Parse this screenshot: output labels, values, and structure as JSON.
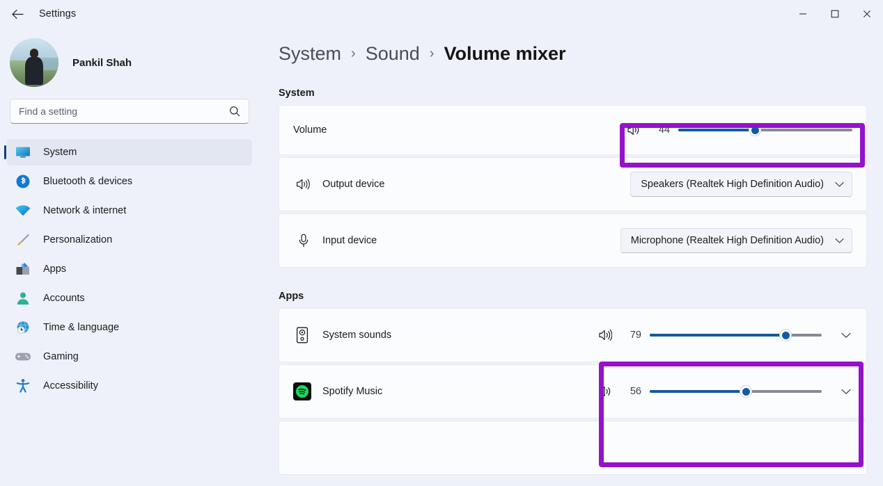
{
  "titlebar": {
    "back_label": "Back",
    "title": "Settings",
    "minimize": "—",
    "maximize": "☐",
    "close": "✕"
  },
  "sidebar": {
    "profile": {
      "name": "Pankil Shah"
    },
    "search": {
      "placeholder": "Find a setting",
      "value": ""
    },
    "items": [
      {
        "label": "System",
        "icon": "monitor-icon",
        "active": true
      },
      {
        "label": "Bluetooth & devices",
        "icon": "bluetooth-icon",
        "active": false
      },
      {
        "label": "Network & internet",
        "icon": "wifi-icon",
        "active": false
      },
      {
        "label": "Personalization",
        "icon": "paintbrush-icon",
        "active": false
      },
      {
        "label": "Apps",
        "icon": "apps-icon",
        "active": false
      },
      {
        "label": "Accounts",
        "icon": "person-icon",
        "active": false
      },
      {
        "label": "Time & language",
        "icon": "clock-globe-icon",
        "active": false
      },
      {
        "label": "Gaming",
        "icon": "gamepad-icon",
        "active": false
      },
      {
        "label": "Accessibility",
        "icon": "accessibility-icon",
        "active": false
      }
    ]
  },
  "breadcrumb": {
    "crumb1": "System",
    "sep1": "›",
    "crumb2": "Sound",
    "sep2": "›",
    "current": "Volume mixer"
  },
  "system_section": {
    "heading": "System",
    "volume_row": {
      "label": "Volume",
      "speaker_icon": "speaker-wave-icon",
      "value": "44",
      "percent": 44
    },
    "output_row": {
      "icon": "speaker-output-icon",
      "label": "Output device",
      "selected": "Speakers (Realtek High Definition Audio)",
      "chevron": "chevron-down-icon"
    },
    "input_row": {
      "icon": "microphone-icon",
      "label": "Input device",
      "selected": "Microphone (Realtek High Definition Audio)",
      "chevron": "chevron-down-icon"
    }
  },
  "apps_section": {
    "heading": "Apps",
    "rows": [
      {
        "label": "System sounds",
        "icon": "system-speaker-icon",
        "speaker_icon": "speaker-wave-icon",
        "value": "79",
        "percent": 79
      },
      {
        "label": "Spotify Music",
        "icon": "spotify-icon",
        "speaker_icon": "speaker-wave-icon",
        "value": "56",
        "percent": 56
      }
    ]
  },
  "colors": {
    "accent_blue": "#14599e",
    "highlight_purple": "#9412c9",
    "page_bg": "#eef1fa",
    "card_bg": "#fbfcfe",
    "track_gray": "#868a94"
  }
}
